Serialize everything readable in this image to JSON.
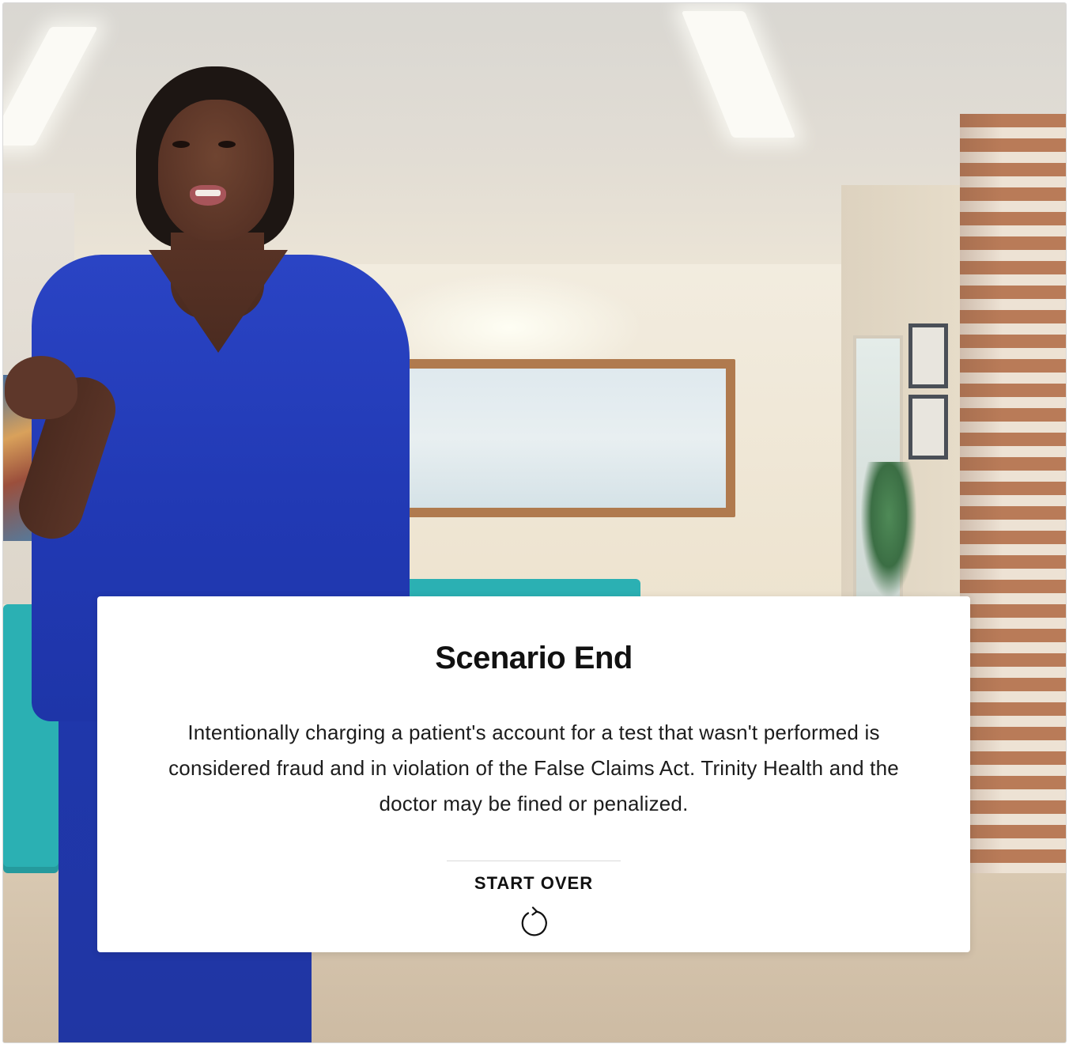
{
  "scenario_card": {
    "title": "Scenario End",
    "message": "Intentionally charging a patient's account for a test that wasn't performed is considered fraud and in violation of the False Claims Act. Trinity Health and the doctor may be fined or penalized.",
    "start_over_label": "START OVER",
    "start_over_icon": "restart-icon"
  },
  "colors": {
    "card_background": "#ffffff",
    "text": "#111111",
    "scrubs": "#2a44c4",
    "sofa": "#2bb0b3"
  }
}
